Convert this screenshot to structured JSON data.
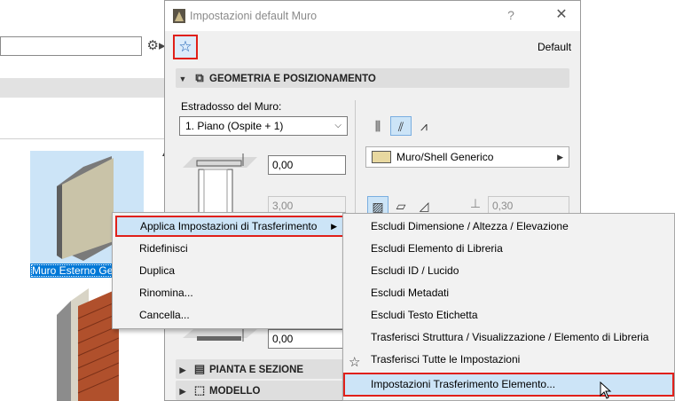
{
  "left_panel": {
    "selected_item_label": "Muro Esterno Ge",
    "gear_icon": "gear-icon"
  },
  "dialog": {
    "title": "Impostazioni default Muro",
    "help_label": "?",
    "close_label": "✕",
    "default_label": "Default",
    "sections": {
      "geometry": "GEOMETRIA E POSIZIONAMENTO",
      "plan": "PIANTA E SEZIONE",
      "model": "MODELLO"
    },
    "top_link_label": "Estradosso del Muro:",
    "top_link_value": "1. Piano (Ospite + 1)",
    "offset_top": "0,00",
    "height": "3,00",
    "offset_bottom": "0,00",
    "material": "Muro/Shell Generico",
    "thickness": "0,30"
  },
  "context_menu": {
    "items": [
      "Applica Impostazioni di Trasferimento",
      "Ridefinisci",
      "Duplica",
      "Rinomina...",
      "Cancella..."
    ]
  },
  "submenu": {
    "items": [
      "Escludi Dimensione / Altezza / Elevazione",
      "Escludi Elemento di Libreria",
      "Escludi ID / Lucido",
      "Escludi Metadati",
      "Escludi Testo Etichetta",
      "Trasferisci Struttura / Visualizzazione / Elemento di Libreria",
      "Trasferisci Tutte le Impostazioni",
      "Impostazioni Trasferimento Elemento..."
    ]
  },
  "colors": {
    "highlight": "#cce4f7",
    "annotation_red": "#e0201a",
    "selection_blue": "#0078d7"
  }
}
